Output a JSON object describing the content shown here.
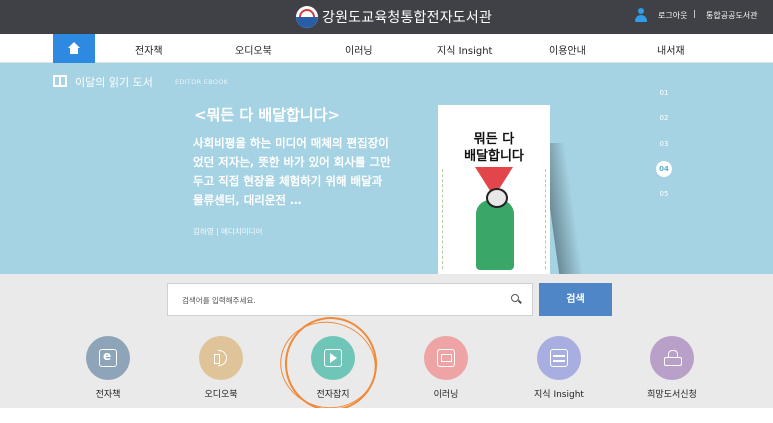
{
  "header": {
    "site_title": "강원도교육청통합전자도서관",
    "logout": "로그아웃",
    "separator": "|",
    "link": "통합공공도서관"
  },
  "nav": {
    "items": [
      {
        "label": "전자책"
      },
      {
        "label": "오디오북"
      },
      {
        "label": "이러닝"
      },
      {
        "label": "지식 Insight"
      },
      {
        "label": "이용안내"
      },
      {
        "label": "내서재"
      }
    ]
  },
  "hero": {
    "section_title": "이달의 읽기 도서",
    "section_sub": "EDITOR EBOOK",
    "book_title": "<뭐든 다 배달합니다>",
    "description": "사회비평을 하는 미디어 매체의 편집장이었던 저자는, 뜻한 바가 있어 회사를 그만두고 직접 현장을 체험하기 위해 배달과 물류센터, 대리운전 …",
    "author": "김하영 | 메디치미디어",
    "cover_title": "뭐든 다\n배달합니다",
    "pages": [
      "01",
      "02",
      "03",
      "04",
      "05"
    ],
    "active_page": "04"
  },
  "search": {
    "placeholder": "검색어를 입력해주세요.",
    "button": "검색"
  },
  "quick_links": [
    {
      "label": "전자책",
      "icon": "ebook-icon",
      "color": "#8ea4b8"
    },
    {
      "label": "오디오북",
      "icon": "audiobook-icon",
      "color": "#dfc49a"
    },
    {
      "label": "전자잡지",
      "icon": "magazine-play-icon",
      "color": "#6fc6b8"
    },
    {
      "label": "이러닝",
      "icon": "elearning-icon",
      "color": "#eea4a4"
    },
    {
      "label": "지식 Insight",
      "icon": "insight-icon",
      "color": "#a8aedf"
    },
    {
      "label": "희망도서신청",
      "icon": "request-icon",
      "color": "#b8a0c8"
    }
  ],
  "colors": {
    "header_bg": "#3f4146",
    "accent_blue": "#2d8ae0",
    "hero_bg": "#a6d3e3",
    "search_button": "#4e86c8",
    "annotation": "#f08a3a"
  }
}
